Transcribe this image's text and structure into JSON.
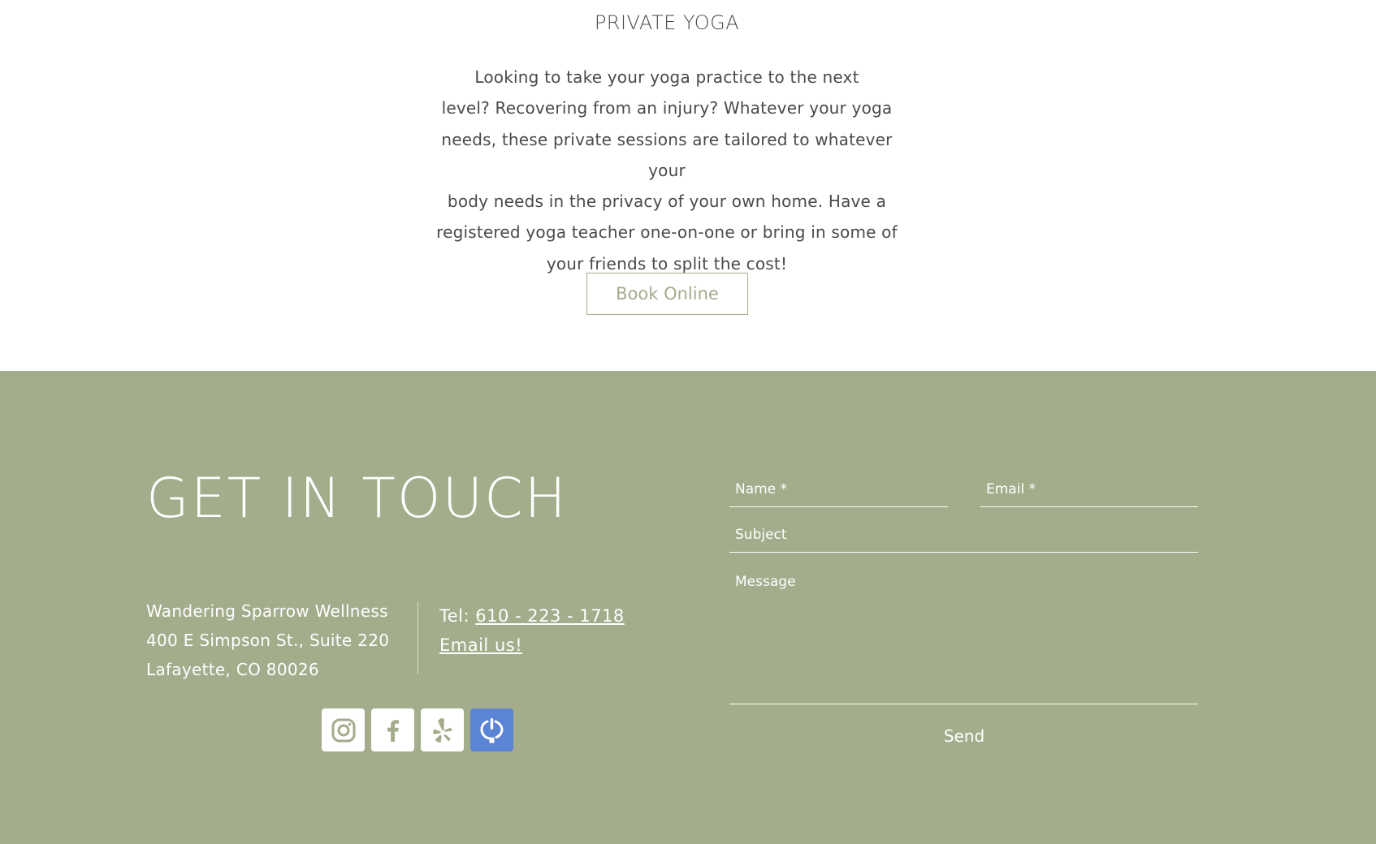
{
  "private_yoga": {
    "title": "PRIVATE YOGA",
    "description_lines": [
      "Looking to take your yoga practice to the next",
      "level? Recovering from an injury? Whatever your yoga",
      "needs, these private sessions are tailored to whatever your",
      "body needs in the privacy of your own home. Have a",
      "registered yoga teacher one-on-one or bring in some of",
      "your friends to split the cost!"
    ],
    "button_label": "Book Online"
  },
  "contact": {
    "heading": "GET IN TOUCH",
    "address": {
      "name": "Wandering Sparrow Wellness",
      "street": "400 E Simpson St., Suite 220",
      "city": "Lafayette, CO 80026"
    },
    "phone_prefix": "Tel: ",
    "phone": "610 - 223 - 1718",
    "email_link": "Email us!",
    "social": [
      {
        "icon": "instagram-icon"
      },
      {
        "icon": "facebook-icon"
      },
      {
        "icon": "yelp-icon"
      },
      {
        "icon": "power-app-icon"
      }
    ],
    "colors": {
      "footer_bg": "#a3ac8b",
      "accent": "#a3ad8c",
      "social_blue": "#5b84d4"
    }
  },
  "form": {
    "name_placeholder": "Name *",
    "email_placeholder": "Email *",
    "subject_placeholder": "Subject",
    "message_placeholder": "Message",
    "send_label": "Send"
  }
}
